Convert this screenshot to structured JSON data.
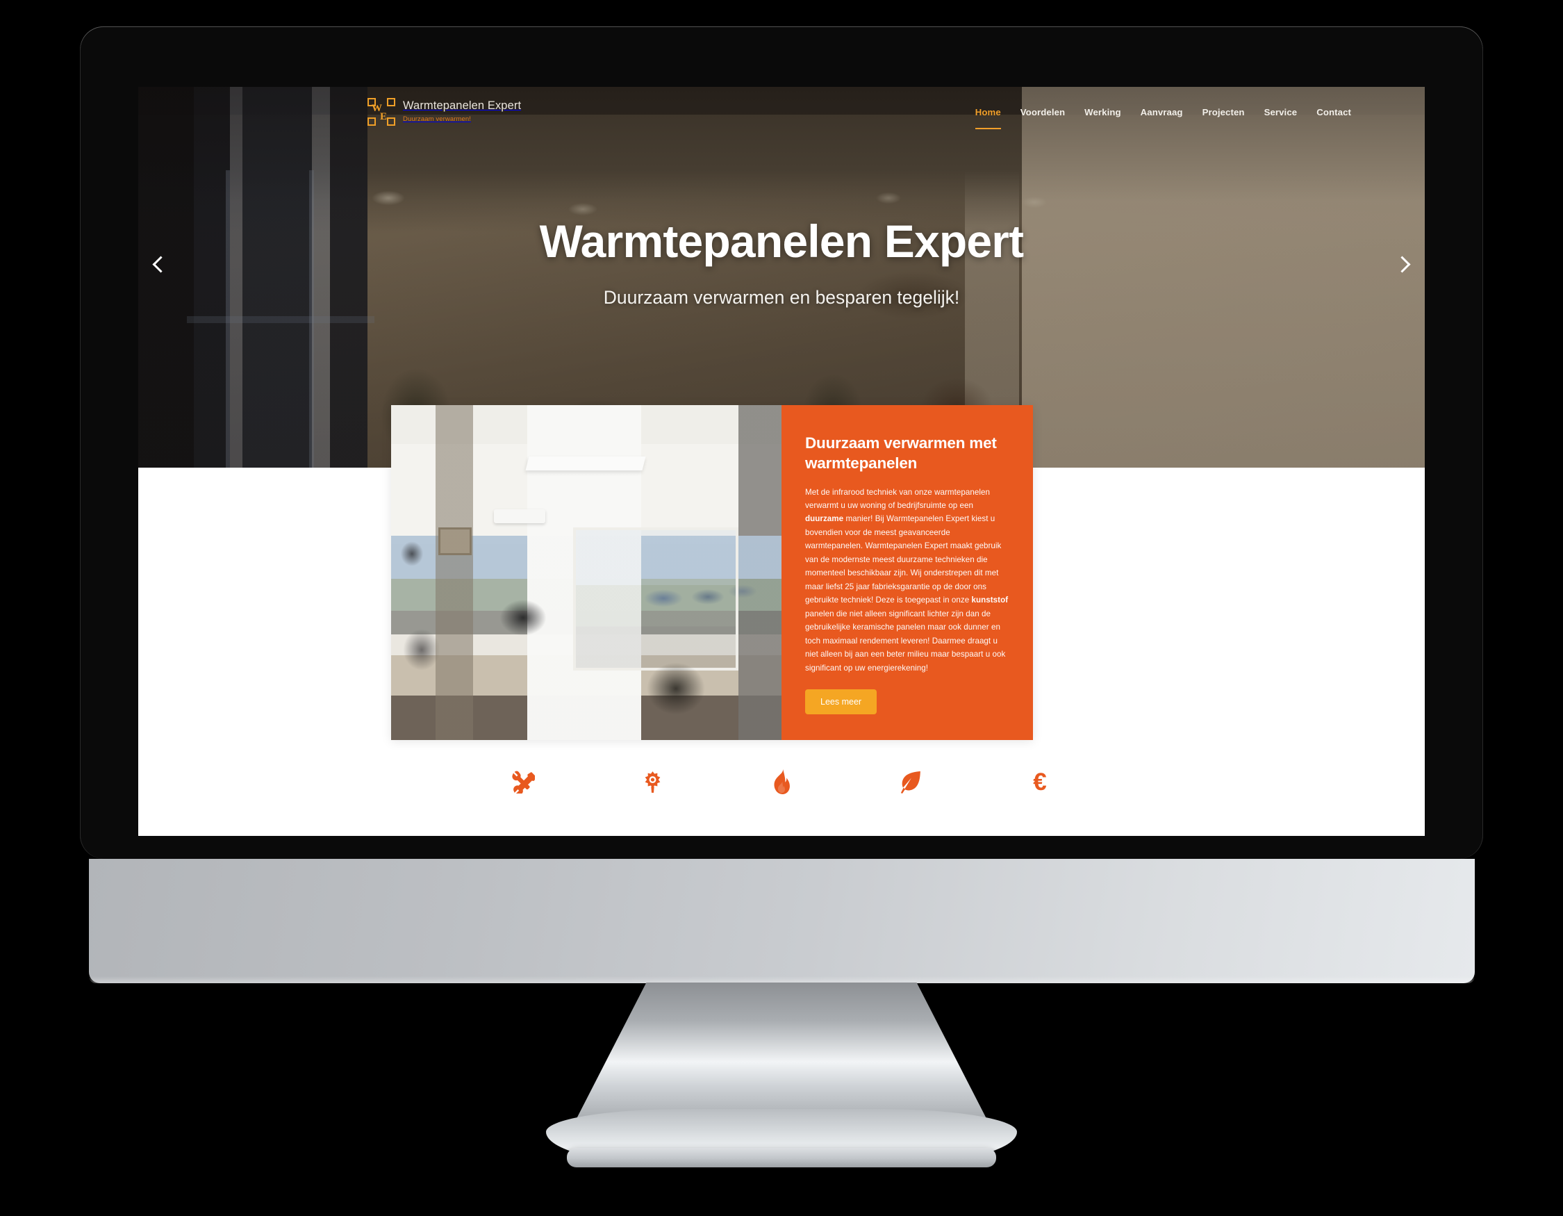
{
  "brand": {
    "mark_letter_1": "W",
    "mark_letter_2": "E",
    "title": "Warmtepanelen Expert",
    "tagline": "Duurzaam verwarmen!"
  },
  "nav": {
    "items": [
      {
        "label": "Home",
        "active": true
      },
      {
        "label": "Voordelen",
        "active": false
      },
      {
        "label": "Werking",
        "active": false
      },
      {
        "label": "Aanvraag",
        "active": false
      },
      {
        "label": "Projecten",
        "active": false
      },
      {
        "label": "Service",
        "active": false
      },
      {
        "label": "Contact",
        "active": false
      }
    ]
  },
  "hero": {
    "title": "Warmtepanelen Expert",
    "subtitle": "Duurzaam verwarmen en besparen tegelijk!",
    "prev_arrow": "‹",
    "next_arrow": "›"
  },
  "feature_card": {
    "title": "Duurzaam verwarmen met warmtepanelen",
    "paragraph_part_1": "Met de infrarood techniek van onze warmtepanelen verwarmt u uw woning of bedrijfsruimte op een ",
    "bold_1": "duurzame",
    "paragraph_part_2": " manier! Bij Warmtepanelen Expert kiest u bovendien voor de meest geavanceerde warmtepanelen. Warmtepanelen Expert maakt gebruik van de modernste meest duurzame technieken die momenteel beschikbaar zijn. Wij onderstrepen dit met maar liefst 25 jaar fabrieksgarantie op de door ons gebruikte techniek! Deze is toegepast in onze ",
    "bold_2": "kunststof",
    "paragraph_part_3": " panelen die niet alleen significant lichter zijn dan de gebruikelijke keramische panelen maar ook dunner en toch maximaal rendement leveren! Daarmee draagt u niet alleen bij aan een beter milieu maar bespaart u ook significant op uw energierekening!",
    "button_label": "Lees meer"
  },
  "icon_strip": {
    "items": [
      {
        "name": "tools-icon"
      },
      {
        "name": "sun-icon"
      },
      {
        "name": "flame-icon"
      },
      {
        "name": "leaf-icon"
      },
      {
        "name": "euro-icon",
        "glyph": "€"
      }
    ]
  },
  "colors": {
    "accent_orange": "#e8591f",
    "brand_amber": "#f0a028",
    "button_amber": "#f5a623",
    "nav_active": "#f2a02a",
    "page_background": "#000000",
    "screen_background": "#ffffff"
  }
}
